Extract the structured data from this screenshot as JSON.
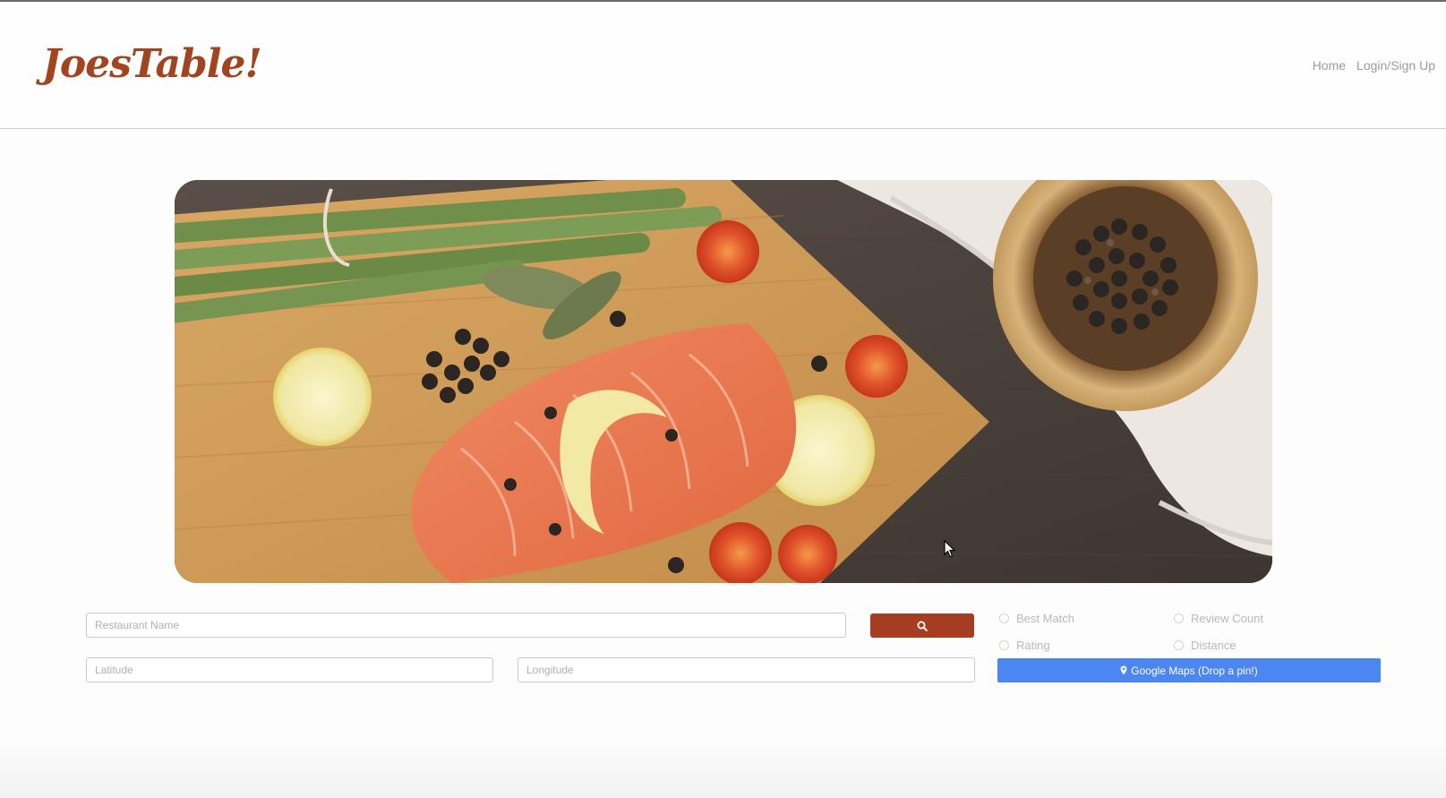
{
  "header": {
    "logo_text": "JoesTable!",
    "nav": {
      "home": "Home",
      "login": "Login/Sign Up"
    }
  },
  "hero": {
    "image_subject": "salmon fillet on cutting board with asparagus, lemons, tomatoes and peppercorns"
  },
  "search": {
    "restaurant_placeholder": "Restaurant Name",
    "latitude_placeholder": "Latitude",
    "longitude_placeholder": "Longitude",
    "search_icon": "search-icon"
  },
  "sort_options": {
    "best_match": "Best Match",
    "review_count": "Review Count",
    "rating": "Rating",
    "distance": "Distance"
  },
  "maps_button": {
    "label": "Google Maps (Drop a pin!)",
    "icon": "map-marker-icon"
  },
  "colors": {
    "brand": "#a0451f",
    "search_button": "#a63d22",
    "maps_button": "#4c86f0",
    "nav_text": "#9b9b9b"
  }
}
